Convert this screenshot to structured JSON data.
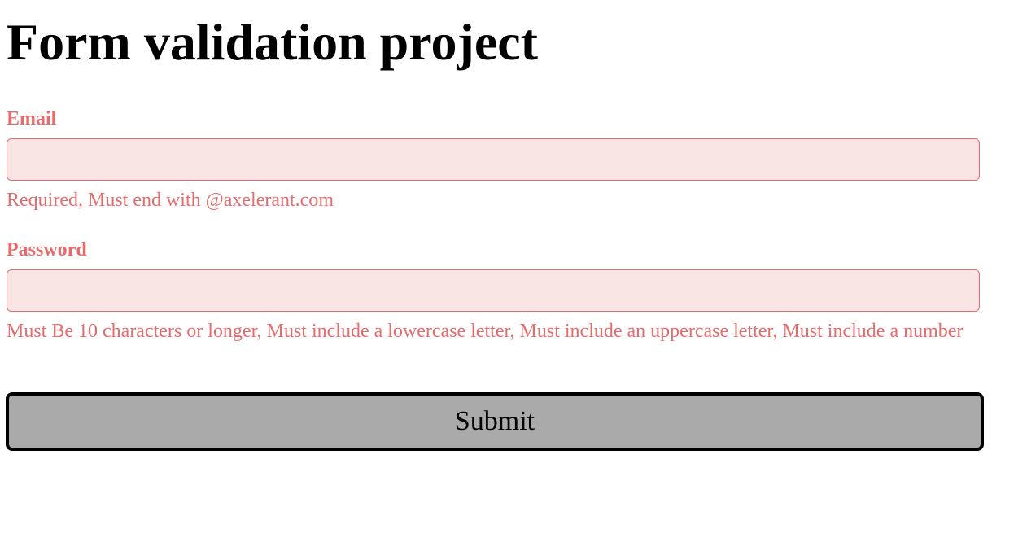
{
  "page": {
    "title": "Form validation project"
  },
  "form": {
    "email": {
      "label": "Email",
      "value": "",
      "placeholder": "",
      "error": "Required, Must end with @axelerant.com"
    },
    "password": {
      "label": "Password",
      "value": "",
      "placeholder": "",
      "error": "Must Be 10 characters or longer, Must include a lowercase letter, Must include an uppercase letter, Must include a number"
    },
    "submit_label": "Submit"
  },
  "colors": {
    "error": "#e56c6c",
    "input_error_bg": "#f9e5e4",
    "button_bg": "#aaaaaa"
  }
}
